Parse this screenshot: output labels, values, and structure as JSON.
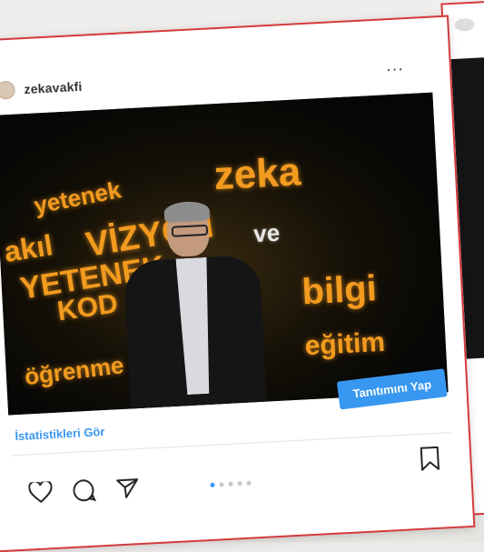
{
  "post": {
    "username": "zekavakfi",
    "more_label": "...",
    "promote_label": "Tanıtımını Yap",
    "insights_label": "İstatistikleri Gör"
  },
  "carousel": {
    "total": 5,
    "active": 1
  },
  "stage_words": [
    "yetenek",
    "zeka",
    "akıl",
    "VİZYON",
    "bilgi",
    "KOD",
    "eğitim",
    "öğrenme",
    "YETENEK",
    "ve"
  ],
  "icons": [
    "heart-icon",
    "comment-icon",
    "share-icon",
    "bookmark-icon",
    "more-icon"
  ],
  "colors": {
    "frame": "#d33a3a",
    "accent": "#3897f0",
    "stage_text": "#f29b1f"
  }
}
